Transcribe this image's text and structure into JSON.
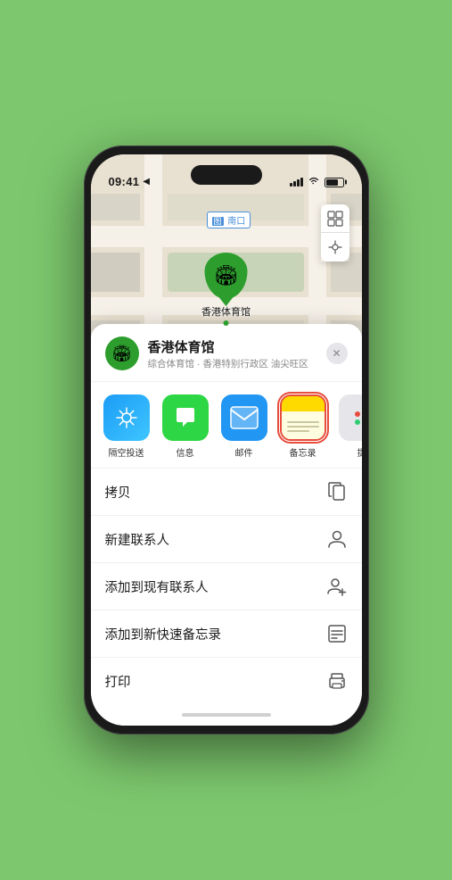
{
  "status_bar": {
    "time": "09:41",
    "location_arrow": "▶"
  },
  "map": {
    "label": "南口",
    "label_prefix": "图",
    "pin_label": "香港体育馆",
    "control_map": "🗺",
    "control_location": "◎"
  },
  "place_card": {
    "name": "香港体育馆",
    "subtitle": "综合体育馆 · 香港特别行政区 油尖旺区",
    "close_label": "✕"
  },
  "apps": [
    {
      "id": "airdrop",
      "label": "隔空投送",
      "icon_type": "airdrop"
    },
    {
      "id": "messages",
      "label": "信息",
      "icon_type": "messages"
    },
    {
      "id": "mail",
      "label": "邮件",
      "icon_type": "mail"
    },
    {
      "id": "notes",
      "label": "备忘录",
      "icon_type": "notes"
    },
    {
      "id": "more",
      "label": "提",
      "icon_type": "more"
    }
  ],
  "actions": [
    {
      "id": "copy",
      "label": "拷贝",
      "icon": "copy"
    },
    {
      "id": "new-contact",
      "label": "新建联系人",
      "icon": "person"
    },
    {
      "id": "add-existing",
      "label": "添加到现有联系人",
      "icon": "person-add"
    },
    {
      "id": "add-notes",
      "label": "添加到新快速备忘录",
      "icon": "note"
    },
    {
      "id": "print",
      "label": "打印",
      "icon": "printer"
    }
  ],
  "colors": {
    "green_pin": "#2d9e2d",
    "map_bg": "#e8e0d0",
    "notes_red": "#e74c3c",
    "notes_yellow": "#ffda00"
  }
}
